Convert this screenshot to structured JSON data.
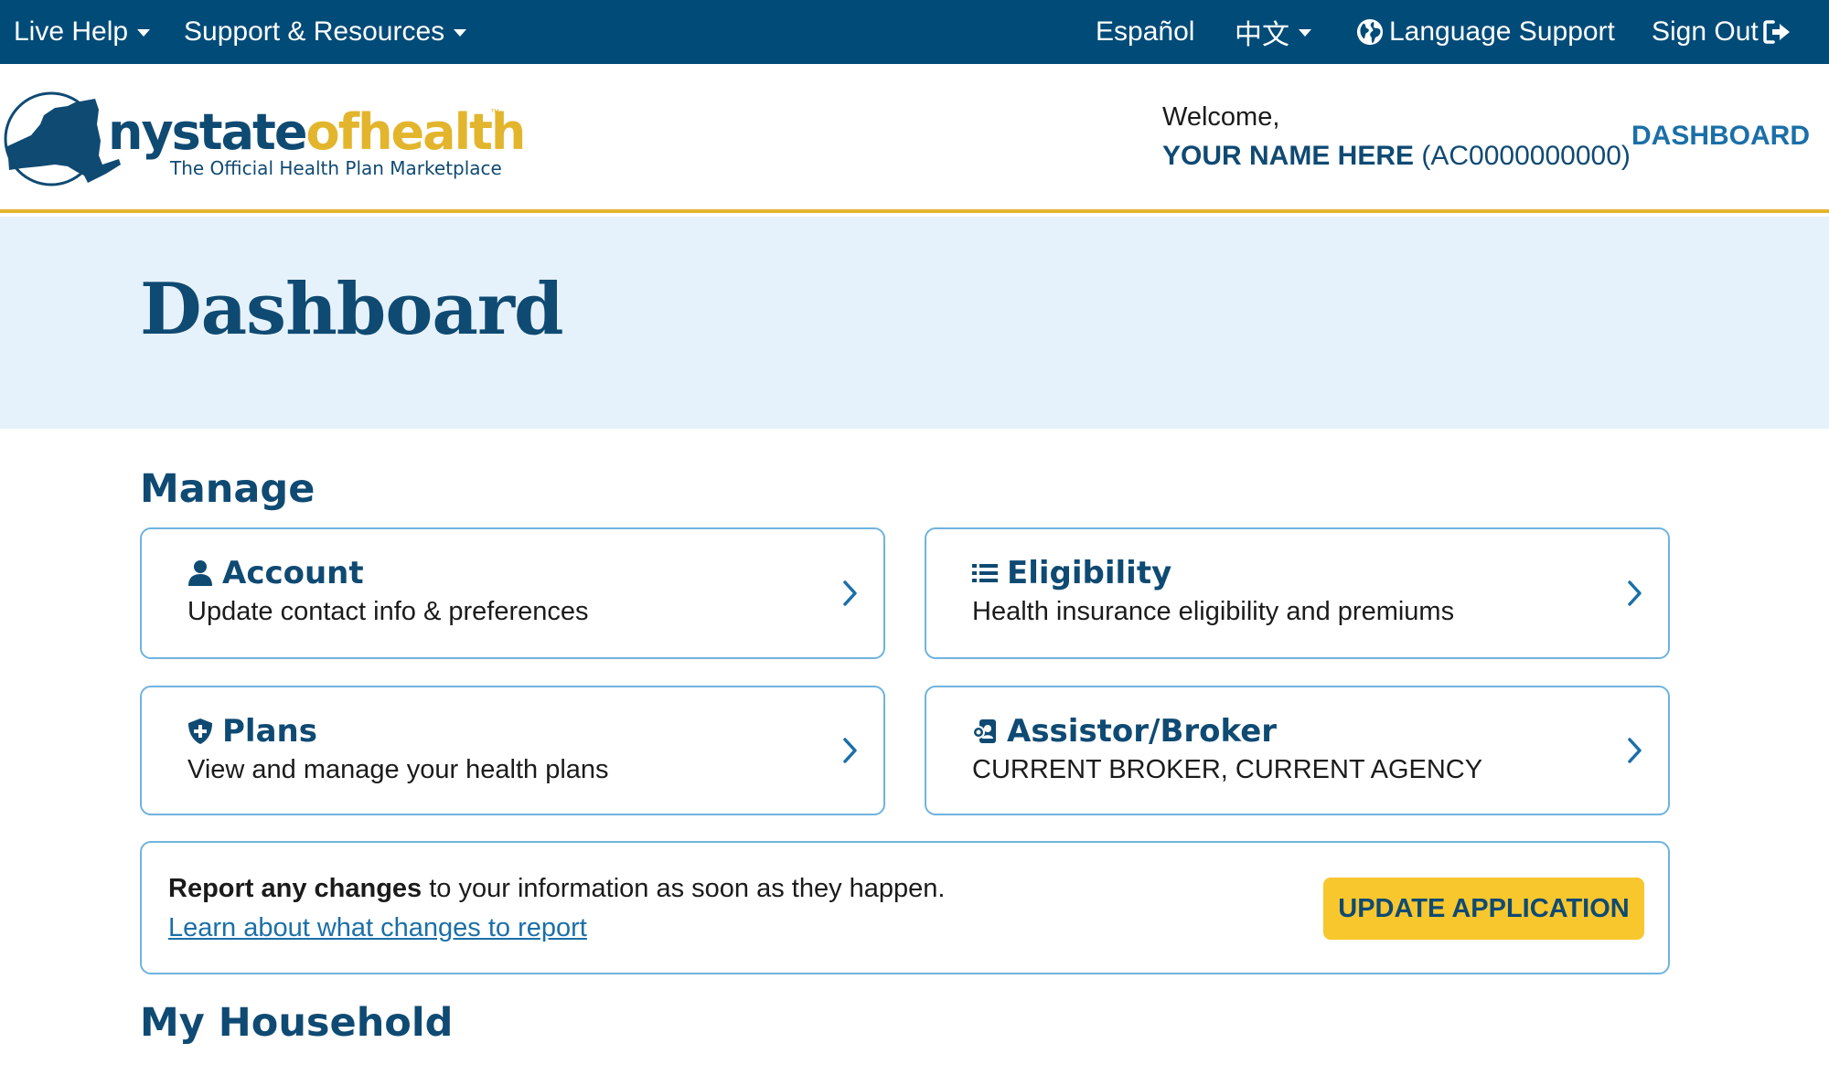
{
  "topbar": {
    "live_help": "Live Help",
    "support": "Support & Resources",
    "espanol": "Español",
    "chinese": "中文",
    "language_support": "Language Support",
    "sign_out": "Sign Out"
  },
  "header": {
    "logo": {
      "word_ny": "nystate",
      "word_of": "ofhealth",
      "trademark": "™",
      "tagline": "The Official Health Plan Marketplace"
    },
    "welcome": "Welcome,",
    "user_name": "YOUR NAME HERE",
    "account_id": "(AC0000000000)",
    "dashboard_link": "DASHBOARD"
  },
  "hero": {
    "title": "Dashboard"
  },
  "manage": {
    "title": "Manage",
    "cards": [
      {
        "title": "Account",
        "description": "Update contact info & preferences",
        "icon": "user-icon"
      },
      {
        "title": "Eligibility",
        "description": "Health insurance eligibility and premiums",
        "icon": "list-icon"
      },
      {
        "title": "Plans",
        "description": "View and manage your health plans",
        "icon": "shield-plus-icon"
      },
      {
        "title": "Assistor/Broker",
        "description": "CURRENT BROKER, CURRENT AGENCY",
        "icon": "id-badge-icon"
      }
    ]
  },
  "notice": {
    "bold": "Report any changes",
    "text": " to your information as soon as they happen.",
    "link": "Learn about what changes to report",
    "button": "UPDATE APPLICATION"
  },
  "household": {
    "title": "My Household"
  },
  "colors": {
    "topbar_bg": "#014b78",
    "brand_navy": "#0f4a73",
    "brand_gold": "#e3b52c",
    "hero_bg": "#e6f2fb",
    "card_border": "#6fb3de",
    "button_yellow": "#f7c72d",
    "link_blue": "#1b6fa8"
  }
}
